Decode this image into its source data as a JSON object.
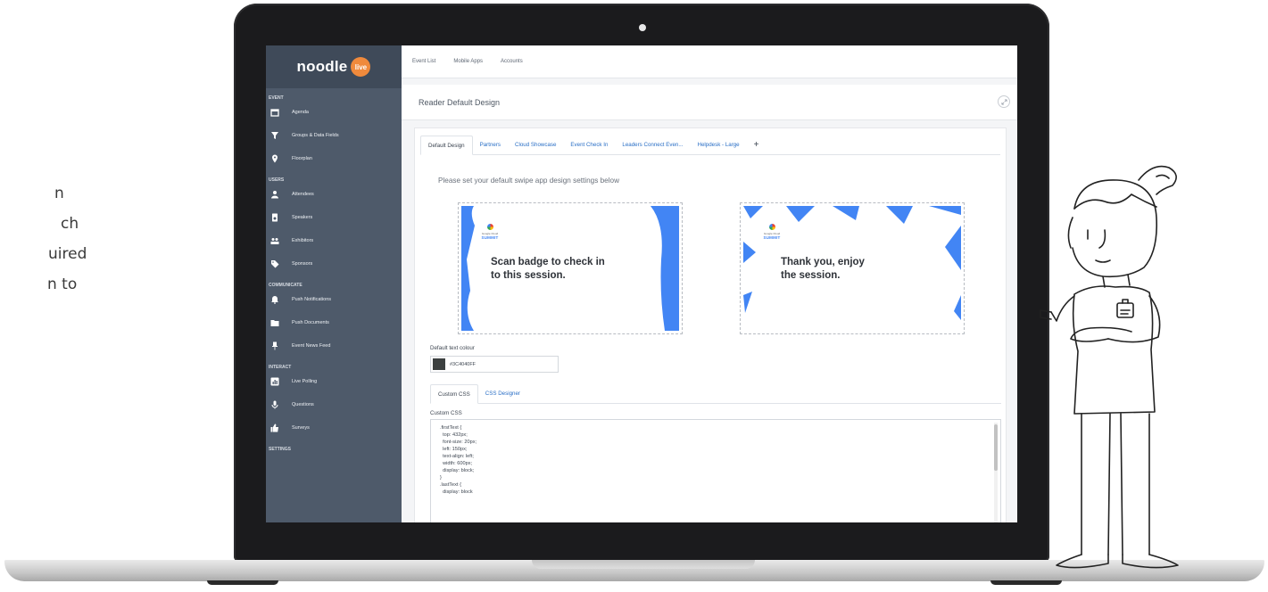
{
  "marketing_text": [
    "n",
    "ch",
    "uired",
    "n to"
  ],
  "colors": {
    "sidebar_bg": "#4e5a6a",
    "link_blue": "#2a6fc6",
    "brand_badge": "#f08a3c",
    "google_blue": "#4285f4"
  },
  "brand": {
    "name": "noodle",
    "badge": "live"
  },
  "sidebar": {
    "sections": [
      {
        "title": "EVENT",
        "items": [
          {
            "label": "Agenda",
            "icon": "calendar-icon"
          },
          {
            "label": "Groups & Data Fields",
            "icon": "filter-icon"
          },
          {
            "label": "Floorplan",
            "icon": "map-pin-icon"
          }
        ]
      },
      {
        "title": "USERS",
        "items": [
          {
            "label": "Attendees",
            "icon": "person-icon"
          },
          {
            "label": "Speakers",
            "icon": "speaker-icon"
          },
          {
            "label": "Exhibitors",
            "icon": "people-icon"
          },
          {
            "label": "Sponsors",
            "icon": "tag-icon"
          }
        ]
      },
      {
        "title": "COMMUNICATE",
        "items": [
          {
            "label": "Push Notifications",
            "icon": "bell-icon"
          },
          {
            "label": "Push Documents",
            "icon": "folder-icon"
          },
          {
            "label": "Event News Feed",
            "icon": "pin-icon"
          }
        ]
      },
      {
        "title": "INTERACT",
        "items": [
          {
            "label": "Live Polling",
            "icon": "poll-icon"
          },
          {
            "label": "Questions",
            "icon": "microphone-icon"
          },
          {
            "label": "Surveys",
            "icon": "thumbs-up-icon"
          }
        ]
      },
      {
        "title": "SETTINGS",
        "items": []
      }
    ]
  },
  "topnav": [
    "Event List",
    "Mobile Apps",
    "Accounts"
  ],
  "page": {
    "title": "Reader Default Design"
  },
  "design_tabs": [
    "Default Design",
    "Partners",
    "Cloud Showcase",
    "Event Check In",
    "Leaders Connect Even...",
    "Helpdesk - Large"
  ],
  "add_tab_symbol": "+",
  "instructions": "Please set your default swipe app design settings below",
  "cards": [
    {
      "logo_small": "Google Cloud",
      "logo_main": "SUMMIT",
      "line1": "Scan badge to check in",
      "line2": "to this session."
    },
    {
      "logo_small": "Google Cloud",
      "logo_main": "SUMMIT",
      "line1": "Thank you, enjoy",
      "line2": "the session."
    }
  ],
  "text_colour": {
    "label": "Default text colour",
    "value": "#3C4040FF",
    "swatch": "#3c4040"
  },
  "css_tabs": [
    "Custom CSS",
    "CSS Designer"
  ],
  "custom_css": {
    "label": "Custom CSS",
    "lines": [
      ".firstText {",
      "  top: 432px;",
      "  font-size: 20px;",
      "  left: 150px;",
      "  text-align: left;",
      "  width: 600px;",
      "  display: block;",
      "}",
      ".lastText {",
      "  display: block"
    ]
  }
}
